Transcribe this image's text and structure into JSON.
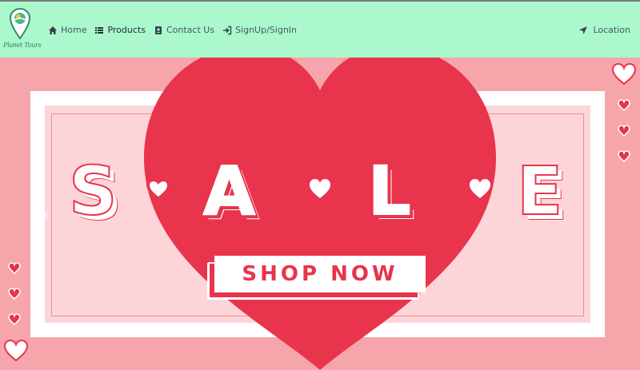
{
  "brand": {
    "logo_text": "Planet Tours"
  },
  "nav": {
    "items": [
      {
        "label": "Home",
        "icon": "home-icon"
      },
      {
        "label": "Products",
        "icon": "list-icon"
      },
      {
        "label": "Contact Us",
        "icon": "contact-book-icon"
      },
      {
        "label": "SignUp/SignIn",
        "icon": "sign-in-icon"
      }
    ],
    "location": {
      "label": "Location",
      "icon": "location-arrow-icon"
    }
  },
  "hero": {
    "letters": [
      "S",
      "A",
      "L",
      "E"
    ],
    "button_label": "SHOP NOW",
    "colors": {
      "accent": "#e8344c",
      "background": "#f6a5ab",
      "panel": "#fdd5d9",
      "nav": "#aaf8cc"
    }
  }
}
